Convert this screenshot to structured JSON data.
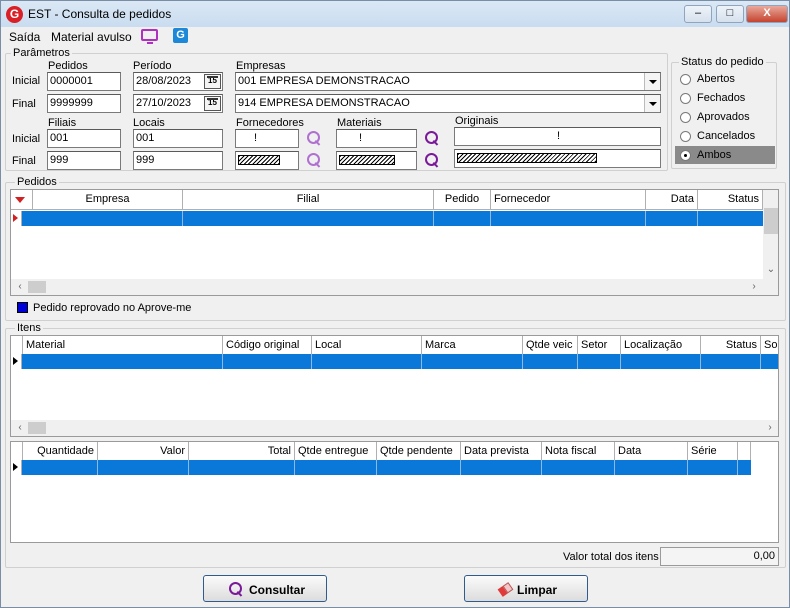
{
  "window": {
    "logo_letter": "G",
    "title": "EST - Consulta de pedidos",
    "minimize": "–",
    "maximize": "□",
    "close": "X"
  },
  "menu": {
    "saida": "Saída",
    "material_avulso": "Material avulso",
    "g_letter": "G"
  },
  "params": {
    "legend": "Parâmetros",
    "inicial": "Inicial",
    "final": "Final",
    "pedidos_label": "Pedidos",
    "pedido_inicial": "0000001",
    "pedido_final": "9999999",
    "periodo_label": "Período",
    "periodo_inicial": "28/08/2023",
    "periodo_final": "27/10/2023",
    "cal_day": "15",
    "empresas_label": "Empresas",
    "empresa_inicial": "001 EMPRESA DEMONSTRACAO",
    "empresa_final": "914 EMPRESA DEMONSTRACAO",
    "filiais_label": "Filiais",
    "filial_inicial": "001",
    "filial_final": "999",
    "locais_label": "Locais",
    "local_inicial": "001",
    "local_final": "999",
    "fornecedores_label": "Fornecedores",
    "fornecedor_inicial": "!",
    "materiais_label": "Materiais",
    "material_inicial": "!",
    "originais_label": "Originais",
    "original_inicial": "!"
  },
  "status": {
    "legend": "Status do pedido",
    "options": [
      "Abertos",
      "Fechados",
      "Aprovados",
      "Cancelados",
      "Ambos"
    ],
    "selected": "Ambos"
  },
  "pedidos": {
    "legend": "Pedidos",
    "columns": [
      "Empresa",
      "Filial",
      "Pedido",
      "Fornecedor",
      "Data",
      "Status"
    ],
    "legend_text": "Pedido reprovado no Aprove-me",
    "legend_color": "#0000d8"
  },
  "itens": {
    "legend": "Itens",
    "columns": [
      "Material",
      "Código original",
      "Local",
      "Marca",
      "Qtde veic",
      "Setor",
      "Localização",
      "Status",
      "So"
    ],
    "columns2": [
      "Quantidade",
      "Valor",
      "Total",
      "Qtde entregue",
      "Qtde pendente",
      "Data prevista",
      "Nota fiscal",
      "Data",
      "Série"
    ],
    "total_label": "Valor total dos itens",
    "total_value": "0,00"
  },
  "buttons": {
    "consultar": "Consultar",
    "limpar": "Limpar"
  },
  "colors": {
    "selection": "#0a78d8",
    "magnifier_light": "#b070d0",
    "magnifier_dark": "#7a1a9a",
    "accent_red": "#d32020"
  }
}
